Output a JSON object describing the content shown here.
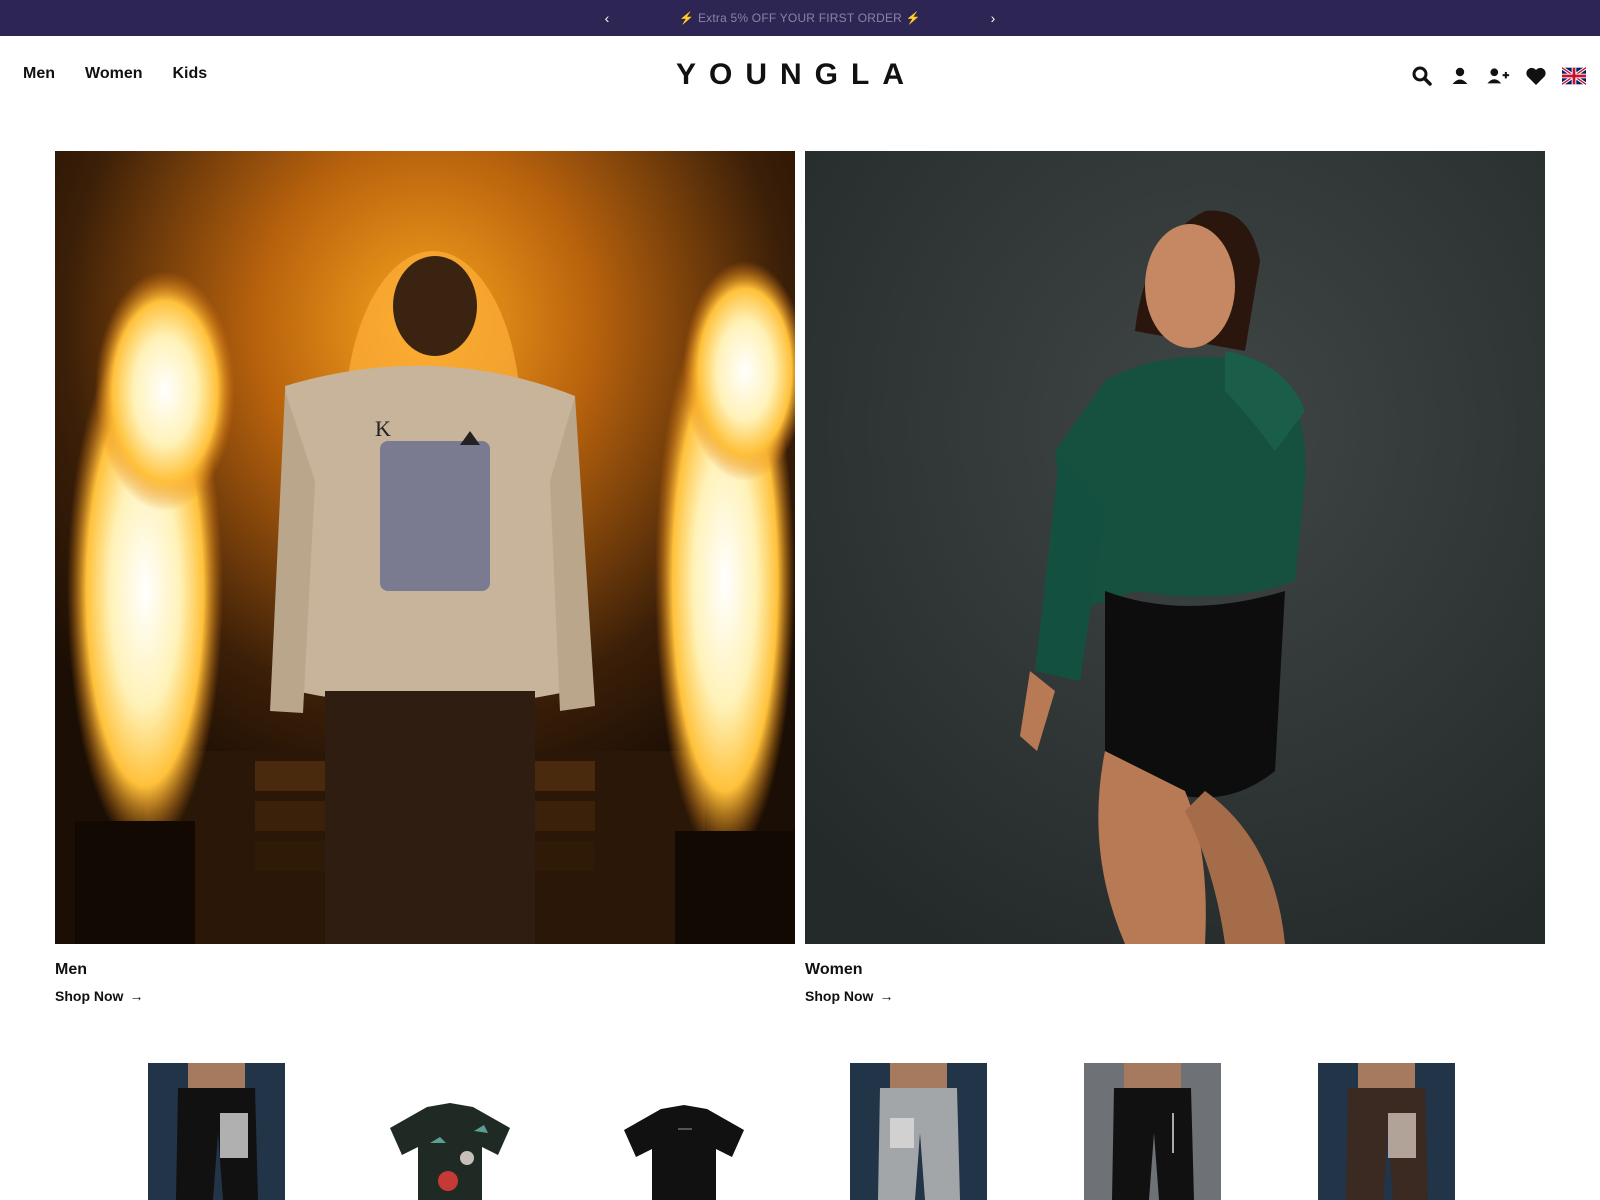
{
  "announcement": {
    "message": "⚡ Extra 5% OFF YOUR FIRST ORDER ⚡",
    "prev_icon": "‹",
    "next_icon": "›"
  },
  "header": {
    "nav": [
      "Men",
      "Women",
      "Kids"
    ],
    "logo": "YOUNGLA",
    "icons": [
      "search-icon",
      "account-icon",
      "register-icon",
      "wishlist-icon",
      "uk-flag-icon"
    ]
  },
  "tiles": [
    {
      "title": "Men",
      "cta": "Shop Now",
      "arrow": "→"
    },
    {
      "title": "Women",
      "cta": "Shop Now",
      "arrow": "→"
    }
  ],
  "products": [
    {
      "image": "black-joggers-photo"
    },
    {
      "image": "black-tee-floral-print-photo"
    },
    {
      "image": "black-tee-plain-photo"
    },
    {
      "image": "grey-joggers-photo"
    },
    {
      "image": "black-joggers-vertical-text-photo"
    },
    {
      "image": "brown-joggers-photo"
    }
  ],
  "colors": {
    "announcement_bg": "#2d2554",
    "text": "#111111"
  }
}
